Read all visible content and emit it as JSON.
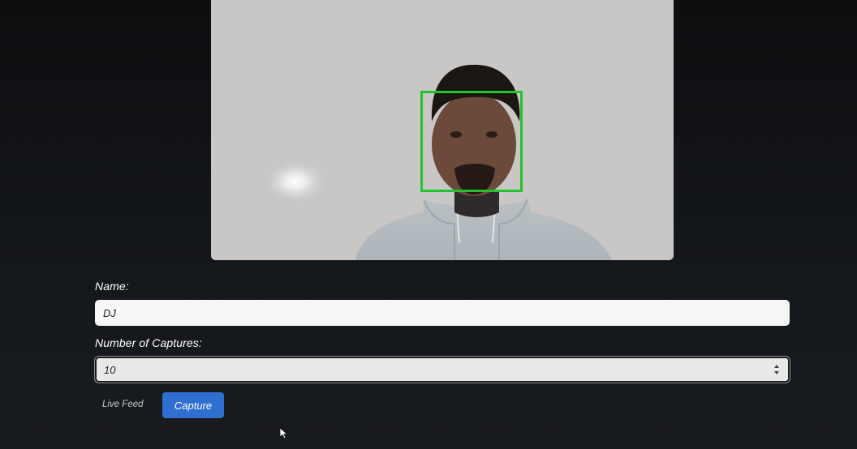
{
  "video": {
    "face_box_color": "#22c32e"
  },
  "form": {
    "name_label": "Name:",
    "name_value": "DJ",
    "captures_label": "Number of Captures:",
    "captures_value": "10"
  },
  "actions": {
    "live_feed_label": "Live Feed",
    "capture_label": "Capture"
  },
  "colors": {
    "accent": "#2f6fd0",
    "background": "#121417"
  },
  "icons": {
    "stepper": "number-stepper-icon",
    "cursor": "mouse-pointer-icon"
  }
}
